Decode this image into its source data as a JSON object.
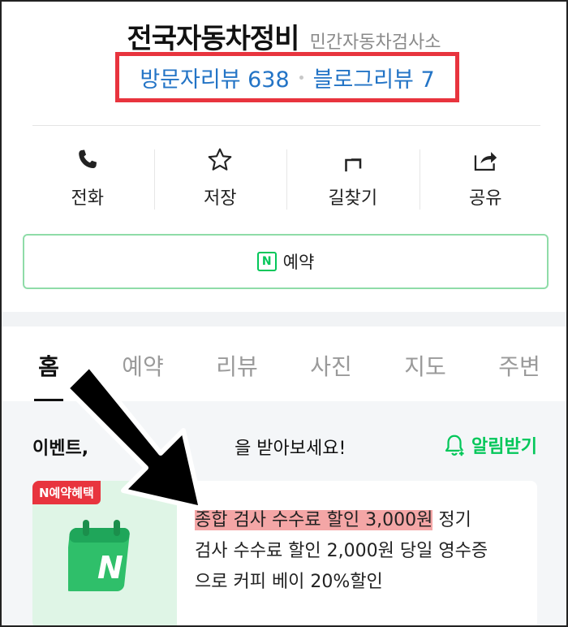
{
  "header": {
    "place_name": "전국자동차정비",
    "category": "민간자동차검사소",
    "visitor_reviews": "방문자리뷰 638",
    "blog_reviews": "블로그리뷰 7"
  },
  "actions": [
    {
      "label": "전화",
      "icon": "phone-icon"
    },
    {
      "label": "저장",
      "icon": "star-icon"
    },
    {
      "label": "길찾기",
      "icon": "directions-icon"
    },
    {
      "label": "공유",
      "icon": "share-icon"
    }
  ],
  "reserve": {
    "label": "예약",
    "icon_letter": "N"
  },
  "tabs": [
    "홈",
    "예약",
    "리뷰",
    "사진",
    "지도",
    "주변"
  ],
  "event": {
    "title_head": "이벤트,",
    "title_tail": "을 받아보세요!",
    "alert_label": "알림받기",
    "badge": "N예약혜택",
    "line1_highlight": "종합 검사 수수료 할인 3,000원",
    "line1_rest": " 정기",
    "line2": "검사 수수료 할인 2,000원 당일 영수증",
    "line3": "으로 커피 베이 20%할인"
  },
  "colors": {
    "accent_green": "#03c75a",
    "link_blue": "#2374c6",
    "annotation_red": "#e8343e",
    "highlight": "#f4a6a6"
  }
}
